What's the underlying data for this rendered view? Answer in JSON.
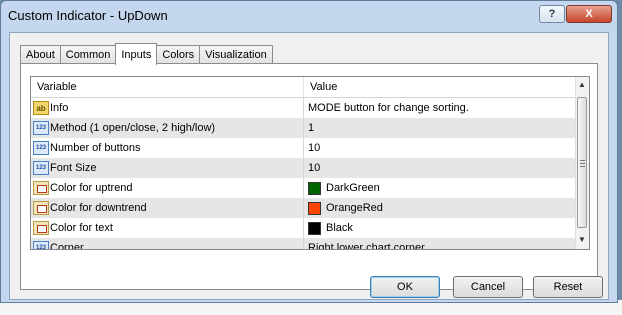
{
  "window": {
    "title": "Custom Indicator - UpDown",
    "help_label": "?",
    "close_label": "X"
  },
  "tabs": [
    {
      "label": "About"
    },
    {
      "label": "Common"
    },
    {
      "label": "Inputs",
      "active": true
    },
    {
      "label": "Colors"
    },
    {
      "label": "Visualization"
    }
  ],
  "grid": {
    "headers": {
      "variable": "Variable",
      "value": "Value"
    },
    "rows": [
      {
        "icon": "ab",
        "variable": "Info",
        "value": "MODE button for change sorting."
      },
      {
        "icon": "123",
        "variable": "Method (1 open/close, 2 high/low)",
        "value": "1"
      },
      {
        "icon": "123",
        "variable": "Number of buttons",
        "value": "10"
      },
      {
        "icon": "123",
        "variable": "Font Size",
        "value": "10"
      },
      {
        "icon": "color",
        "variable": "Color for uptrend",
        "value": "DarkGreen",
        "swatch": "#006400"
      },
      {
        "icon": "color",
        "variable": "Color for downtrend",
        "value": "OrangeRed",
        "swatch": "#ff4500"
      },
      {
        "icon": "color",
        "variable": "Color for text",
        "value": "Black",
        "swatch": "#000000"
      },
      {
        "icon": "123",
        "variable": "Corner",
        "value": "Right lower chart corner"
      }
    ]
  },
  "buttons": {
    "ok": "OK",
    "cancel": "Cancel",
    "reset": "Reset"
  }
}
